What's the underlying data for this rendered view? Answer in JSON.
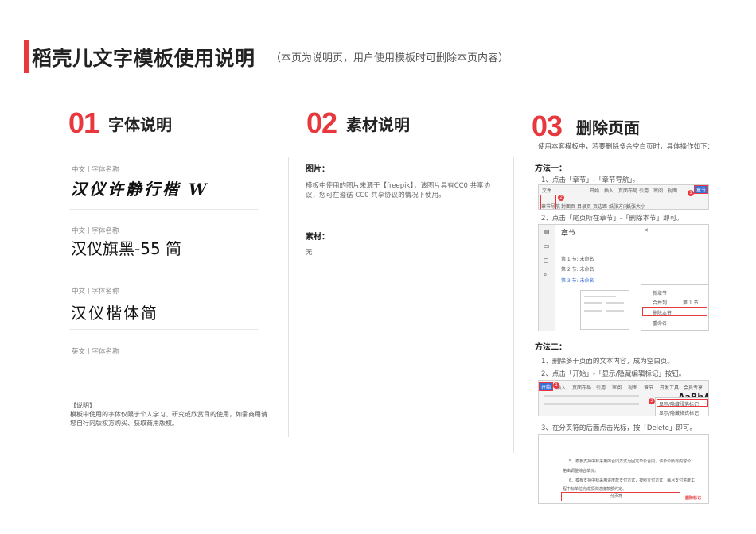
{
  "header": {
    "title": "稻壳儿文字模板使用说明",
    "subtitle": "（本页为说明页，用户使用模板时可删除本页内容）"
  },
  "section1": {
    "num": "01",
    "title": "字体说明",
    "fonts": [
      {
        "label": "中文丨字体名称",
        "sample": "汉仪许静行楷 W"
      },
      {
        "label": "中文丨字体名称",
        "sample": "汉仪旗黑-55 简"
      },
      {
        "label": "中文丨字体名称",
        "sample": "汉仪楷体简"
      },
      {
        "label": "英文丨字体名称",
        "sample": ""
      }
    ],
    "note_title": "【说明】",
    "note_text": "模板中使用的字体仅限于个人学习、研究或欣赏目的使用，如需商用请您自行向版权方购买、获取商用版权。"
  },
  "section2": {
    "num": "02",
    "title": "素材说明",
    "images_label": "图片：",
    "images_text": "模板中使用的图片来源于【freepik】，该图片具有CC0 共享协议，您可在遵循 CC0 共享协议的情况下使用。",
    "material_label": "素材：",
    "material_text": "无"
  },
  "section3": {
    "num": "03",
    "title": "删除页面",
    "intro": "使用本套模板中，若要删除多余空白页时，具体操作如下：",
    "method1": "方法一：",
    "m1_step1": "1、点击「章节」-「章节导航」。",
    "m1_step2": "2、点击「尾页所在章节」-「删除本节」即可。",
    "method2": "方法二：",
    "m2_step1": "1、删除多于页面的文本内容，成为空白页。",
    "m2_step2": "2、点击「开始」-「显示/隐藏编辑标记」按钮。",
    "m2_step3": "3、在分页符的后面点击光标，按「Delete」即可。",
    "shot_b": {
      "panel_title": "章节",
      "items": [
        "第 1 节: 未命名",
        "第 2 节: 未命名",
        "第 3 节: 未命名"
      ],
      "menu": [
        "新增节",
        "合并到",
        "删除本节",
        "重命名"
      ],
      "merge_value": "第 1 节"
    },
    "shot_a": {
      "tabs": [
        "文件",
        "开始",
        "插入",
        "页面布局",
        "引用",
        "审阅",
        "视图",
        "章节"
      ],
      "tools": [
        "章节导航",
        "封面页",
        "目录页",
        "页边距",
        "纸张方向",
        "纸张大小"
      ]
    },
    "shot_c": {
      "tabs": [
        "开始",
        "插入",
        "页面布局",
        "引用",
        "审阅",
        "视图",
        "章节",
        "开发工具",
        "会员专享"
      ],
      "menu": [
        "显示/隐藏段落标记",
        "显示/隐藏格式标记"
      ],
      "style_sample": "AaBbAa"
    },
    "shot_d": {
      "line1": "5、模板支持中标采用的合同方式为固定单价合同，该单价所有内容价",
      "line2": "格由调整综合单价。",
      "line3": "6、模板支持中标采用进度款支付方式，按照支付方式，每月支付进度工",
      "line4": "程中标单位完成投资进度款额约定。",
      "pagebreak": "分页符",
      "marker": "删除标记"
    }
  }
}
